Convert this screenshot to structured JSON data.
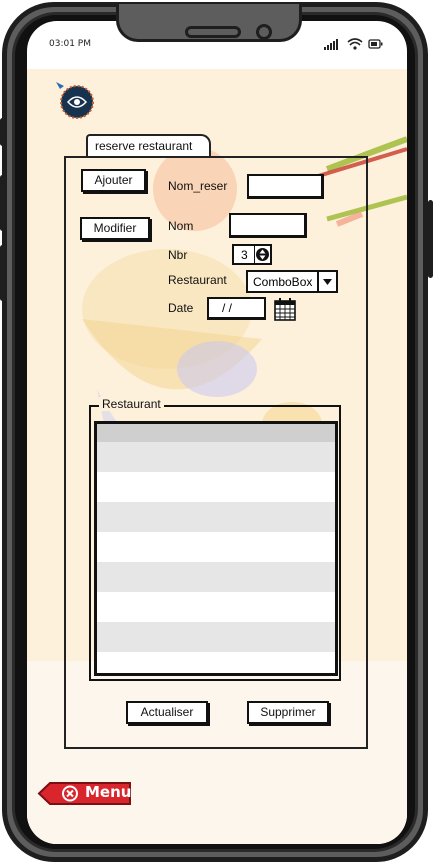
{
  "status_bar": {
    "time": "03:01 PM"
  },
  "tab": {
    "label": "reserve restaurant"
  },
  "form": {
    "ajouter_label": "Ajouter",
    "modifier_label": "Modifier",
    "nom_reser_label": "Nom_reser",
    "nom_label": "Nom",
    "nbr_label": "Nbr",
    "nbr_value": "3",
    "restaurant_label": "Restaurant",
    "restaurant_combo_value": "ComboBox",
    "date_label": "Date",
    "date_value": "/ /"
  },
  "group": {
    "title": "Restaurant",
    "rows": [
      "",
      "",
      "",
      "",
      "",
      "",
      "",
      ""
    ]
  },
  "actions": {
    "actualiser_label": "Actualiser",
    "supprimer_label": "Supprimer"
  },
  "menu": {
    "label": "Menu"
  },
  "colors": {
    "background": "#fdf1dc",
    "menu_red": "#d9262c",
    "phone_frame": "#5d5d5d"
  },
  "icons": [
    "signal-icon",
    "wifi-icon",
    "battery-icon",
    "logo-icon",
    "calendar-icon",
    "close-circle-icon",
    "spinner-arrows-icon",
    "dropdown-arrow-icon"
  ]
}
